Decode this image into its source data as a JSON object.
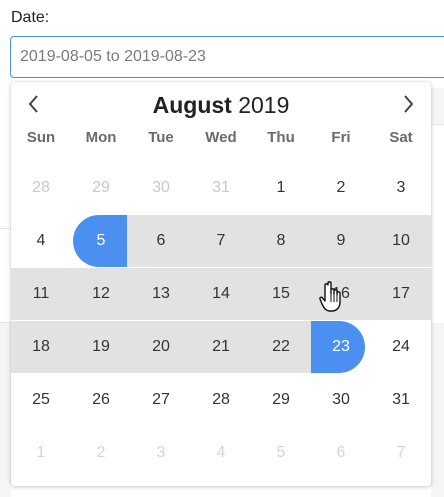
{
  "field": {
    "label": "Date:",
    "value": "2019-08-05 to 2019-08-23"
  },
  "calendar": {
    "month": "August",
    "year": "2019",
    "weekdays": [
      "Sun",
      "Mon",
      "Tue",
      "Wed",
      "Thu",
      "Fri",
      "Sat"
    ],
    "weeks": [
      [
        "28",
        "29",
        "30",
        "31",
        "1",
        "2",
        "3"
      ],
      [
        "4",
        "5",
        "6",
        "7",
        "8",
        "9",
        "10"
      ],
      [
        "11",
        "12",
        "13",
        "14",
        "15",
        "16",
        "17"
      ],
      [
        "18",
        "19",
        "20",
        "21",
        "22",
        "23",
        "24"
      ],
      [
        "25",
        "26",
        "27",
        "28",
        "29",
        "30",
        "31"
      ],
      [
        "1",
        "2",
        "3",
        "4",
        "5",
        "6",
        "7"
      ]
    ],
    "range_start": "5",
    "range_end": "23"
  },
  "icons": {
    "prev": "chevron-left-icon",
    "next": "chevron-right-icon",
    "cursor": "hand-pointer-icon"
  },
  "colors": {
    "accent": "#4b90f0",
    "range": "#e2e2e2",
    "border": "#4a8fe6"
  }
}
